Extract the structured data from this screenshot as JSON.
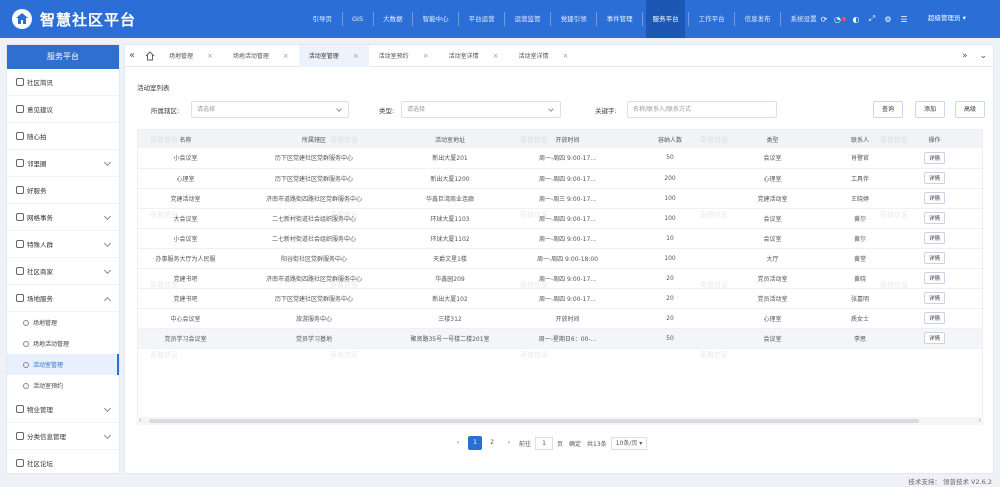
{
  "app": {
    "title": "智慧社区平台"
  },
  "nav": {
    "items": [
      "引导页",
      "GIS",
      "大数据",
      "智能中心",
      "平台运营",
      "运营监管",
      "党建引领",
      "事件管理",
      "服务平台",
      "工作平台",
      "信息发布",
      "系统设置"
    ],
    "active": "服务平台",
    "user": "超级管理员"
  },
  "sidebar": {
    "title": "服务平台",
    "items": [
      {
        "label": "社区简讯",
        "icon": "document-icon"
      },
      {
        "label": "意见建议",
        "icon": "chat-icon"
      },
      {
        "label": "随心拍",
        "icon": "flag-icon"
      },
      {
        "label": "邻里圈",
        "icon": "circle-icon",
        "expandable": true
      },
      {
        "label": "好服务",
        "icon": "service-icon"
      },
      {
        "label": "网格事务",
        "icon": "grid-icon",
        "expandable": true
      },
      {
        "label": "特殊人群",
        "icon": "people-icon",
        "expandable": true
      },
      {
        "label": "社区商家",
        "icon": "shop-icon",
        "expandable": true
      },
      {
        "label": "场地服务",
        "icon": "venue-icon",
        "expandable": true,
        "open": true,
        "children": [
          "场地管理",
          "场地活动管理",
          "活动室管理",
          "活动室预约"
        ],
        "active_child": "活动室管理"
      },
      {
        "label": "物业管理",
        "icon": "building-icon",
        "expandable": true
      },
      {
        "label": "分类信息管理",
        "icon": "list-icon",
        "expandable": true
      },
      {
        "label": "社区论坛",
        "icon": "forum-icon"
      }
    ]
  },
  "tabs": {
    "items": [
      "场地管理",
      "场地活动管理",
      "活动室管理",
      "活动室预约",
      "活动室详情",
      "活动室详情"
    ],
    "active": "活动室管理"
  },
  "page": {
    "section_title": "活动室列表",
    "filters": {
      "area_label": "所属辖区:",
      "area_placeholder": "请选择",
      "type_label": "类型:",
      "type_placeholder": "请选择",
      "keyword_label": "关键字:",
      "keyword_placeholder": "名称/联系人/联系方式"
    },
    "buttons": {
      "search": "查询",
      "add": "添加",
      "advanced": "高级"
    },
    "table": {
      "columns": [
        "名称",
        "所属辖区",
        "活动室地址",
        "开放时间",
        "容纳人数",
        "类型",
        "联系人",
        "操作"
      ],
      "rows": [
        [
          "小会议室",
          "历下区党建社区党群服务中心",
          "新出大厦201",
          "周一-周四 9:00-17...",
          "50",
          "会议室",
          "肖警官",
          "详情"
        ],
        [
          "心理室",
          "历下区党建社区党群服务中心",
          "新出大厦1200",
          "周一-周四 9:00-17...",
          "200",
          "心理室",
          "工具伴",
          "详情"
        ],
        [
          "党建活动室",
          "济南市道路街四路社区党群服务中心",
          "华鑫巨湾商业连廊",
          "周一-周三 9:00-17...",
          "100",
          "党建活动室",
          "王晓婷",
          "详情"
        ],
        [
          "大会议室",
          "二七新村街道社会组织服务中心",
          "环球大厦1103",
          "周一-周四 9:00-17...",
          "100",
          "会议室",
          "黄尔",
          "详情"
        ],
        [
          "小会议室",
          "二七新村街道社会组织服务中心",
          "环球大厦1102",
          "周一-周四 9:00-17...",
          "10",
          "会议室",
          "黄尔",
          "详情"
        ],
        [
          "办事服务大厅为人民服",
          "阳谷街社区党群服务中心",
          "天爵文星1楼",
          "周一-周四 9:00-18:00",
          "100",
          "大厅",
          "黄堂",
          "详情"
        ],
        [
          "党建书吧",
          "济南市道路街四路社区党群服务中心",
          "华鑫园209",
          "周一-周四 9:00-17...",
          "20",
          "党员活动室",
          "黄晓",
          "详情"
        ],
        [
          "党建书吧",
          "历下区党建社区党群服务中心",
          "新出大厦102",
          "周一-周四 9:00-17...",
          "20",
          "党员活动室",
          "张嘉明",
          "详情"
        ],
        [
          "中心会议室",
          "旅游服务中心",
          "三楼312",
          "开放时间",
          "20",
          "心理室",
          "质女士",
          "详情"
        ],
        [
          "党员学习会议室",
          "党员学习基地",
          "聚贤路35号一号楼二楼201室",
          "周一-星期日6：00-...",
          "50",
          "会议室",
          "李思",
          "详情"
        ]
      ]
    },
    "pagination": {
      "pages": [
        "1",
        "2"
      ],
      "active": "1",
      "goto_label": "前往",
      "goto_value": "1",
      "page_suffix": "页",
      "confirm": "确定",
      "total": "共13条",
      "page_size": "10条/页"
    },
    "watermark": "奇普信息"
  },
  "footer": {
    "text": "技术支持： 领普技术  V2.6.2"
  },
  "colors": {
    "primary": "#2b6fd6",
    "nav_active": "#1d57b4",
    "sidebar_head": "#2f6fd0"
  }
}
